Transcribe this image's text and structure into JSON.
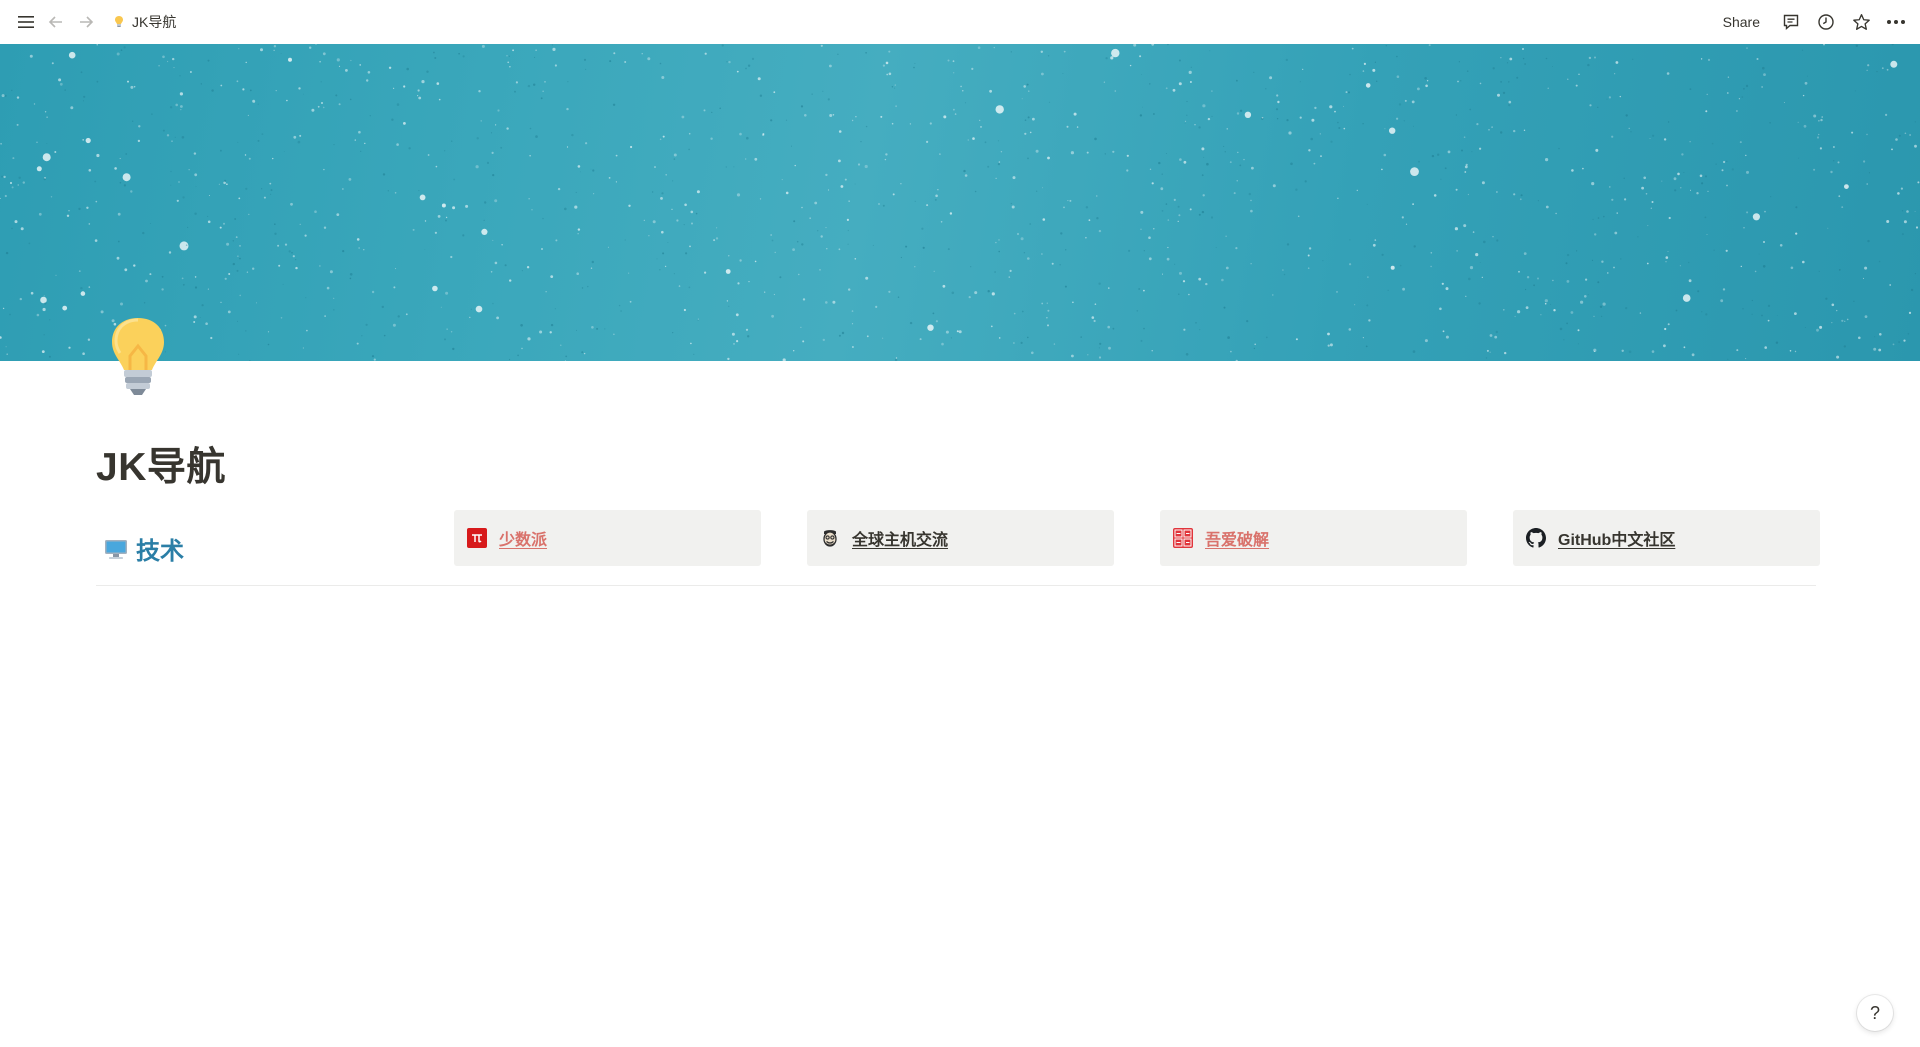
{
  "topbar": {
    "breadcrumb_title": "JK导航",
    "share_label": "Share"
  },
  "page": {
    "title": "JK导航",
    "icon": "lightbulb-icon"
  },
  "section": {
    "title": "技术",
    "icon": "desktop-computer-icon",
    "title_color": "#2a7ea6"
  },
  "links": [
    {
      "label": "少数派",
      "icon": "sspai-logo-icon",
      "color": "#d9726b"
    },
    {
      "label": "全球主机交流",
      "icon": "hostloc-avatar-icon",
      "color": "#37352f"
    },
    {
      "label": "吾爱破解",
      "icon": "52pojie-seal-icon",
      "color": "#d9726b"
    },
    {
      "label": "GitHub中文社区",
      "icon": "github-icon",
      "color": "#37352f"
    }
  ],
  "help": {
    "label": "?"
  },
  "colors": {
    "cover": "#3aa7bb",
    "card_bg": "#f1f1ef",
    "text": "#37352f"
  }
}
